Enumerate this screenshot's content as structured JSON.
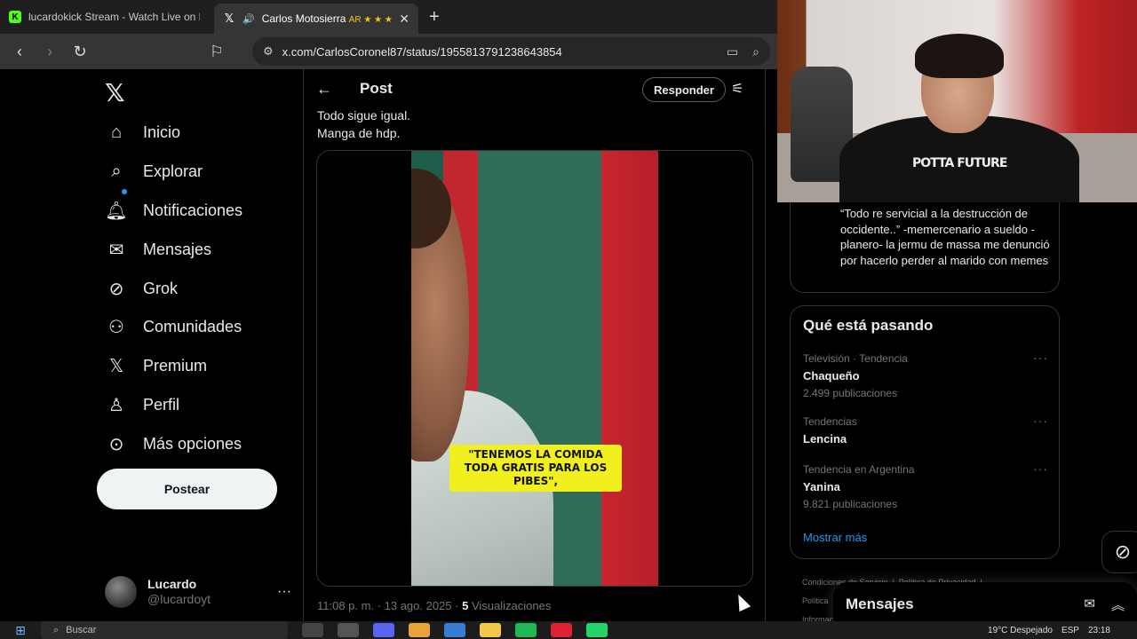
{
  "browser": {
    "tabs": [
      {
        "title": "lucardokick Stream - Watch Live on K",
        "favicon": "kick-logo-icon",
        "active": false
      },
      {
        "title": "Carlos Motosierra",
        "badge": "AR ★ ★ ★",
        "favicon": "x-logo-icon",
        "active": true
      }
    ],
    "url": "x.com/CarlosCoronel87/status/1955813791238643854"
  },
  "nav": {
    "items": [
      {
        "label": "Inicio",
        "icon": "home-icon"
      },
      {
        "label": "Explorar",
        "icon": "search-icon"
      },
      {
        "label": "Notificaciones",
        "icon": "bell-icon"
      },
      {
        "label": "Mensajes",
        "icon": "mail-icon"
      },
      {
        "label": "Grok",
        "icon": "grok-icon"
      },
      {
        "label": "Comunidades",
        "icon": "communities-icon"
      },
      {
        "label": "Premium",
        "icon": "x-logo-icon"
      },
      {
        "label": "Perfil",
        "icon": "person-icon"
      },
      {
        "label": "Más opciones",
        "icon": "more-circle-icon"
      }
    ],
    "post_button": "Postear",
    "account": {
      "name": "Lucardo",
      "handle": "@lucardoyt"
    }
  },
  "post": {
    "header_title": "Post",
    "reply_button": "Responder",
    "text_lines": [
      "Todo sigue igual.",
      "Manga de hdp."
    ],
    "video_caption": "\"TENEMOS LA COMIDA TODA GRATIS PARA LOS PIBES\",",
    "meta": {
      "time": "11:08 p. m. · 13 ago. 2025 · ",
      "views_count": "5",
      "views_label": "Visualizaciones"
    }
  },
  "webcam": {
    "shirt_text": "POTTA FUTURE"
  },
  "quoted_bio": "“Todo re servicial a la destrucción de occidente..” -memercenario a sueldo -planero- la jermu de massa me denunció por hacerlo perder al marido con memes",
  "trends": {
    "title": "Qué está pasando",
    "items": [
      {
        "context": "Televisión · Tendencia",
        "name": "Chaqueño",
        "count": "2.499 publicaciones"
      },
      {
        "context": "Tendencias",
        "name": "Lencina",
        "count": ""
      },
      {
        "context": "Tendencia en Argentina",
        "name": "Yanina",
        "count": "9.821 publicaciones"
      }
    ],
    "show_more": "Mostrar más"
  },
  "footer": {
    "link1": "Condiciones de Servicio",
    "link2": "Política de Privacidad",
    "line2": "Política",
    "line3": "Informac"
  },
  "messages_drawer": {
    "title": "Mensajes"
  },
  "taskbar": {
    "search_placeholder": "Buscar",
    "weather": "19°C  Despejado",
    "lang": "ESP",
    "time": "23:18"
  }
}
